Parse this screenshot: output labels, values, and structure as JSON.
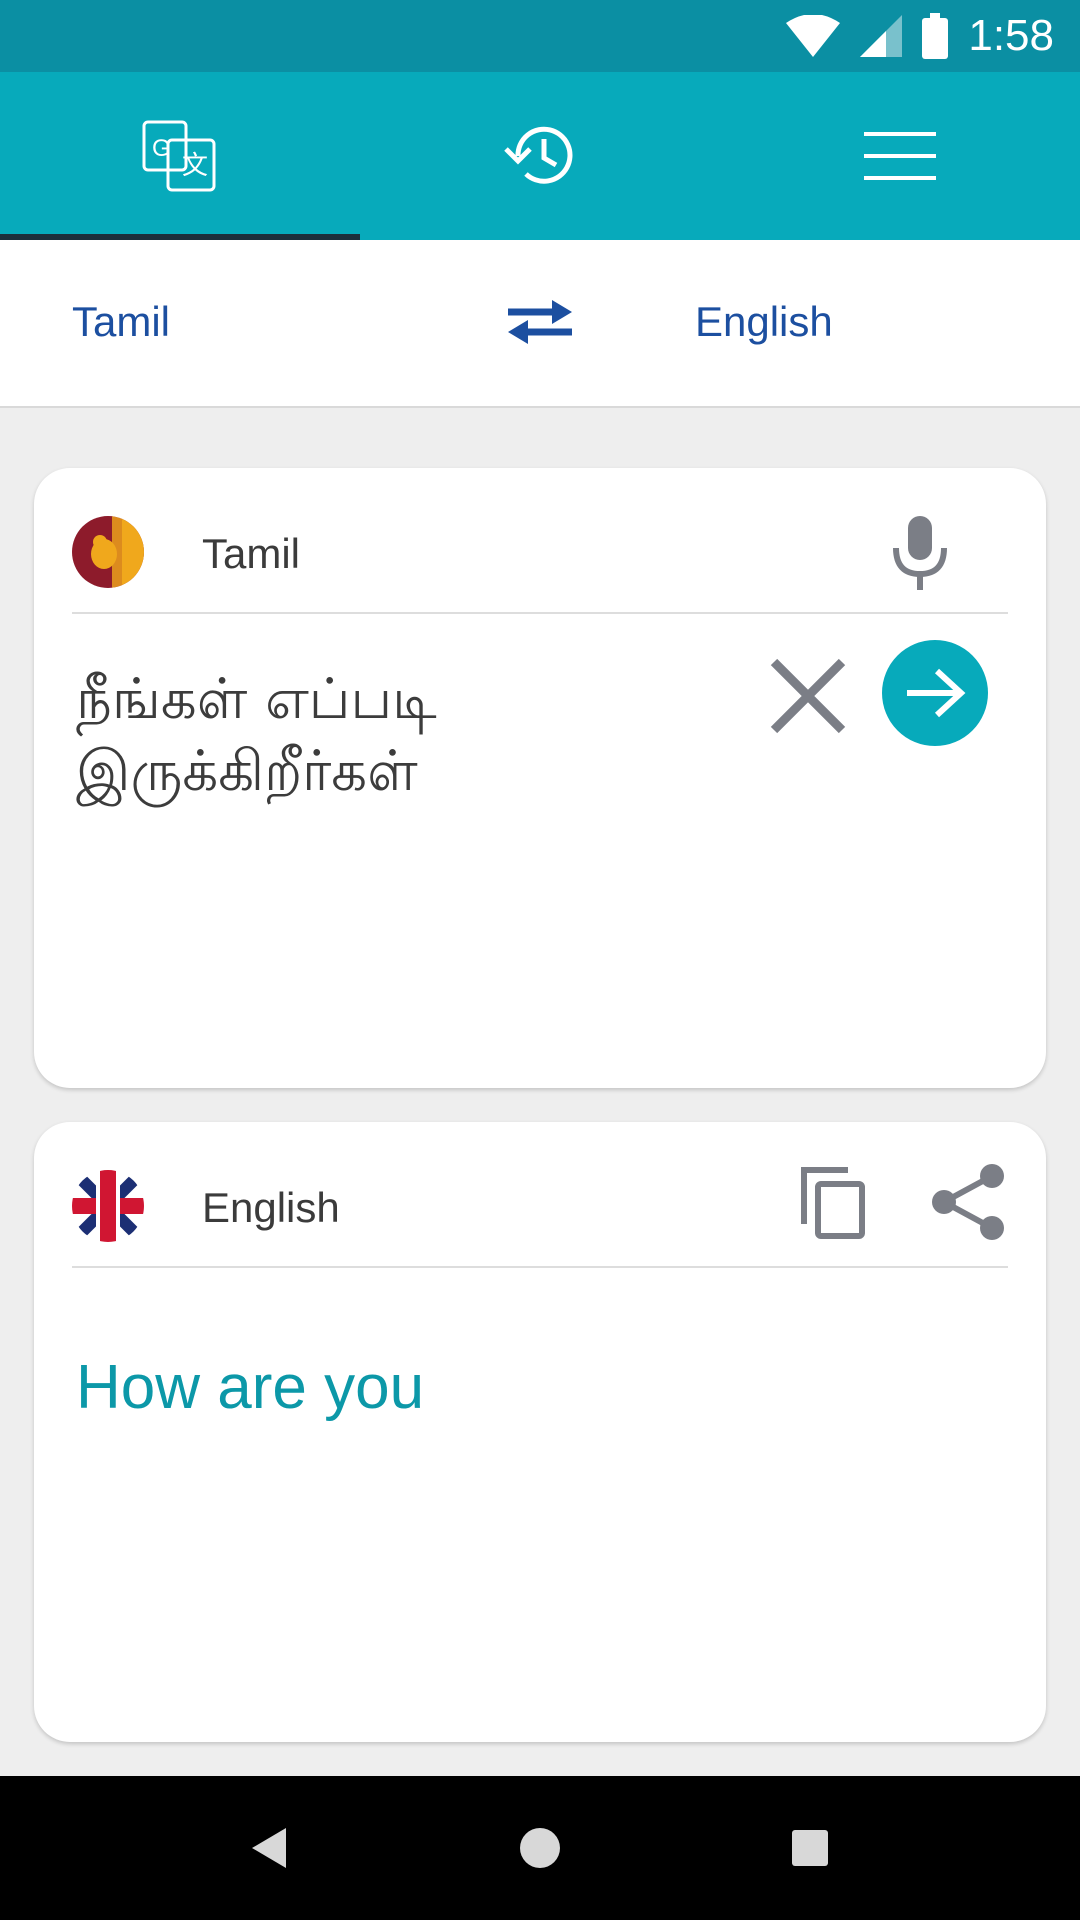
{
  "status_bar": {
    "time": "1:58",
    "icons": [
      "wifi-icon",
      "signal-icon",
      "battery-icon"
    ]
  },
  "tabs": [
    {
      "name": "translate",
      "icon": "translate-icon",
      "active": true
    },
    {
      "name": "history",
      "icon": "history-icon",
      "active": false
    },
    {
      "name": "menu",
      "icon": "menu-icon",
      "active": false
    }
  ],
  "language_bar": {
    "source": "Tamil",
    "target": "English",
    "swap_icon": "swap-arrows-icon"
  },
  "source_card": {
    "language": "Tamil",
    "flag": "sri-lanka-flag",
    "text": "நீங்கள் எப்படி இருக்கிறீர்கள்",
    "icons": [
      "mic-icon",
      "clear-icon",
      "translate-go-icon"
    ]
  },
  "result_card": {
    "language": "English",
    "flag": "uk-flag",
    "text": "How are you",
    "icons": [
      "copy-icon",
      "share-icon"
    ]
  },
  "colors": {
    "status_bar": "#0b8fa3",
    "toolbar": "#07aabb",
    "accent_text": "#1c4fa0",
    "result_text": "#0c98a8"
  },
  "nav_bar": {
    "icons": [
      "back-icon",
      "home-icon",
      "recents-icon"
    ]
  }
}
